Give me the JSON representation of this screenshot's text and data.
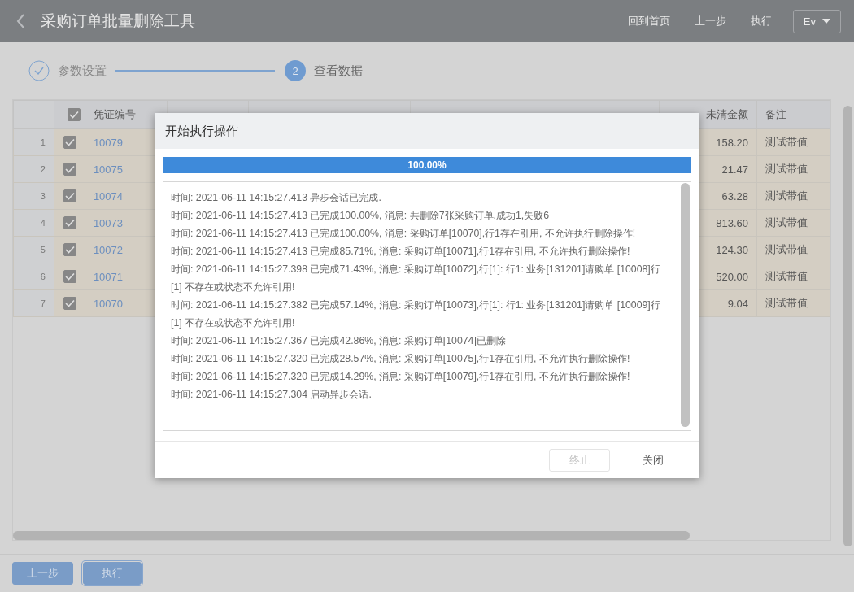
{
  "header": {
    "title": "采购订单批量删除工具",
    "actions": [
      {
        "label": "回到首页"
      },
      {
        "label": "上一步"
      },
      {
        "label": "执行"
      }
    ],
    "user_menu": {
      "label": "Ev"
    }
  },
  "steps": [
    {
      "label": "参数设置",
      "done": true,
      "current": false
    },
    {
      "label": "查看数据",
      "number": "2",
      "done": false,
      "current": true
    }
  ],
  "table": {
    "header_checked": true,
    "columns": [
      {
        "label": "凭证编号"
      },
      {
        "label": "未清金额"
      },
      {
        "label": "备注"
      }
    ],
    "rows": [
      {
        "index": "1",
        "checked": true,
        "voucher": "10079",
        "outstanding": "158.20",
        "note": "测试带值"
      },
      {
        "index": "2",
        "checked": true,
        "voucher": "10075",
        "outstanding": "21.47",
        "note": "测试带值"
      },
      {
        "index": "3",
        "checked": true,
        "voucher": "10074",
        "outstanding": "63.28",
        "note": "测试带值"
      },
      {
        "index": "4",
        "checked": true,
        "voucher": "10073",
        "outstanding": "813.60",
        "note": "测试带值"
      },
      {
        "index": "5",
        "checked": true,
        "voucher": "10072",
        "outstanding": "124.30",
        "note": "测试带值"
      },
      {
        "index": "6",
        "checked": true,
        "voucher": "10071",
        "outstanding": "520.00",
        "note": "测试带值"
      },
      {
        "index": "7",
        "checked": true,
        "voucher": "10070",
        "outstanding": "9.04",
        "note": "测试带值"
      }
    ]
  },
  "footer_buttons": [
    {
      "label": "上一步",
      "focused": false
    },
    {
      "label": "执行",
      "focused": true
    }
  ],
  "dialog": {
    "title": "开始执行操作",
    "progress": {
      "level": 1.0,
      "label": "100.00%"
    },
    "log": [
      "时间: 2021-06-11 14:15:27.413 异步会话已完成.",
      "时间: 2021-06-11 14:15:27.413 已完成100.00%, 消息: 共删除7张采购订单,成功1,失败6",
      "时间: 2021-06-11 14:15:27.413 已完成100.00%, 消息: 采购订单[10070],行1存在引用, 不允许执行删除操作!",
      "时间: 2021-06-11 14:15:27.413 已完成85.71%, 消息: 采购订单[10071],行1存在引用, 不允许执行删除操作!",
      "时间: 2021-06-11 14:15:27.398 已完成71.43%, 消息: 采购订单[10072],行[1]: 行1: 业务[131201]请购单 [10008]行[1] 不存在或状态不允许引用!",
      "时间: 2021-06-11 14:15:27.382 已完成57.14%, 消息: 采购订单[10073],行[1]: 行1: 业务[131201]请购单 [10009]行[1] 不存在或状态不允许引用!",
      "时间: 2021-06-11 14:15:27.367 已完成42.86%, 消息: 采购订单[10074]已删除",
      "时间: 2021-06-11 14:15:27.320 已完成28.57%, 消息: 采购订单[10075],行1存在引用, 不允许执行删除操作!",
      "时间: 2021-06-11 14:15:27.320 已完成14.29%, 消息: 采购订单[10079],行1存在引用, 不允许执行删除操作!",
      "时间: 2021-06-11 14:15:27.304 启动异步会话."
    ],
    "buttons": [
      {
        "label": "终止",
        "disabled": true
      },
      {
        "label": "关闭",
        "disabled": false
      }
    ]
  }
}
